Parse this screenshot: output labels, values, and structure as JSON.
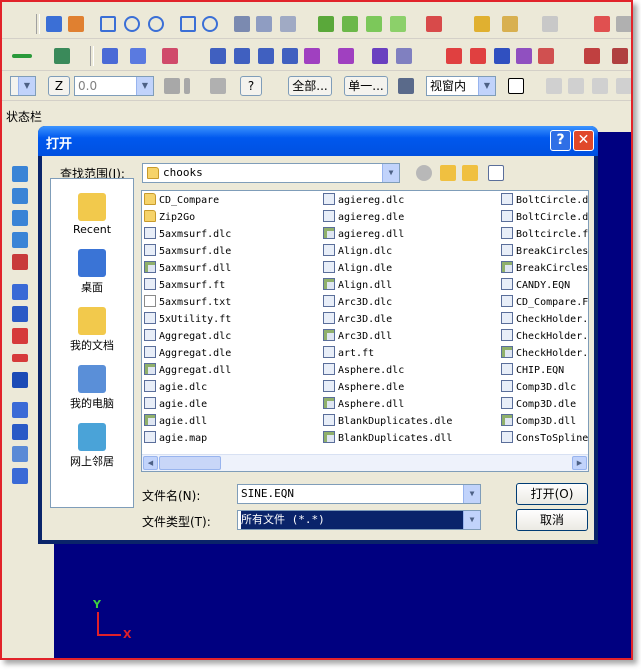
{
  "toolbar3": {
    "z_label": "Z",
    "z_value": "0.0",
    "all_button": "全部...",
    "single_button": "单一...",
    "view_select": "视窗内",
    "help_icon": "?"
  },
  "status_label": "状态栏",
  "dialog": {
    "title": "打开",
    "help_btn": "?",
    "close_btn": "✕",
    "lookin_label": "查找范围(I):",
    "lookin_value": "chooks",
    "places": [
      {
        "label": "Recent",
        "icon": "recent-folder-icon",
        "color": "#f2c94c"
      },
      {
        "label": "桌面",
        "icon": "desktop-icon",
        "color": "#3a74d6"
      },
      {
        "label": "我的文档",
        "icon": "my-documents-icon",
        "color": "#f2c94c"
      },
      {
        "label": "我的电脑",
        "icon": "my-computer-icon",
        "color": "#5a8fd8"
      },
      {
        "label": "网上邻居",
        "icon": "network-icon",
        "color": "#4aa3d8"
      }
    ],
    "columns": [
      [
        {
          "name": "CD_Compare",
          "type": "folder"
        },
        {
          "name": "Zip2Go",
          "type": "folder"
        },
        {
          "name": "5axmsurf.dlc",
          "type": "file"
        },
        {
          "name": "5axmsurf.dle",
          "type": "file"
        },
        {
          "name": "5axmsurf.dll",
          "type": "dll"
        },
        {
          "name": "5axmsurf.ft",
          "type": "file"
        },
        {
          "name": "5axmsurf.txt",
          "type": "txt"
        },
        {
          "name": "5xUtility.ft",
          "type": "file"
        },
        {
          "name": "Aggregat.dlc",
          "type": "file"
        },
        {
          "name": "Aggregat.dle",
          "type": "file"
        },
        {
          "name": "Aggregat.dll",
          "type": "dll"
        },
        {
          "name": "agie.dlc",
          "type": "file"
        },
        {
          "name": "agie.dle",
          "type": "file"
        },
        {
          "name": "agie.dll",
          "type": "dll"
        },
        {
          "name": "agie.map",
          "type": "file"
        }
      ],
      [
        {
          "name": "agiereg.dlc",
          "type": "file"
        },
        {
          "name": "agiereg.dle",
          "type": "file"
        },
        {
          "name": "agiereg.dll",
          "type": "dll"
        },
        {
          "name": "Align.dlc",
          "type": "file"
        },
        {
          "name": "Align.dle",
          "type": "file"
        },
        {
          "name": "Align.dll",
          "type": "dll"
        },
        {
          "name": "Arc3D.dlc",
          "type": "file"
        },
        {
          "name": "Arc3D.dle",
          "type": "file"
        },
        {
          "name": "Arc3D.dll",
          "type": "dll"
        },
        {
          "name": "art.ft",
          "type": "file"
        },
        {
          "name": "Asphere.dlc",
          "type": "file"
        },
        {
          "name": "Asphere.dle",
          "type": "file"
        },
        {
          "name": "Asphere.dll",
          "type": "dll"
        },
        {
          "name": "BlankDuplicates.dle",
          "type": "file"
        },
        {
          "name": "BlankDuplicates.dll",
          "type": "dll"
        }
      ],
      [
        {
          "name": "BoltCircle.d",
          "type": "file"
        },
        {
          "name": "BoltCircle.d",
          "type": "file"
        },
        {
          "name": "Boltcircle.f",
          "type": "file"
        },
        {
          "name": "BreakCircles",
          "type": "file"
        },
        {
          "name": "BreakCircles",
          "type": "dll"
        },
        {
          "name": "CANDY.EQN",
          "type": "file"
        },
        {
          "name": "CD_Compare.F",
          "type": "file"
        },
        {
          "name": "CheckHolder.",
          "type": "file"
        },
        {
          "name": "CheckHolder.",
          "type": "file"
        },
        {
          "name": "CheckHolder.",
          "type": "dll"
        },
        {
          "name": "CHIP.EQN",
          "type": "file"
        },
        {
          "name": "Comp3D.dlc",
          "type": "file"
        },
        {
          "name": "Comp3D.dle",
          "type": "file"
        },
        {
          "name": "Comp3D.dll",
          "type": "dll"
        },
        {
          "name": "ConsToSpline",
          "type": "file"
        }
      ]
    ],
    "filename_label": "文件名(N):",
    "filename_value": "SINE.EQN",
    "filetype_label": "文件类型(T):",
    "filetype_value": "所有文件 (*.*)",
    "open_button": "打开(O)",
    "cancel_button": "取消"
  },
  "axes": {
    "y": "Y",
    "x": "X"
  },
  "colors": {
    "frame": "#e2232a",
    "canvas": "#000080",
    "titlebar": "#0058ee",
    "axis": "#e0202a"
  }
}
